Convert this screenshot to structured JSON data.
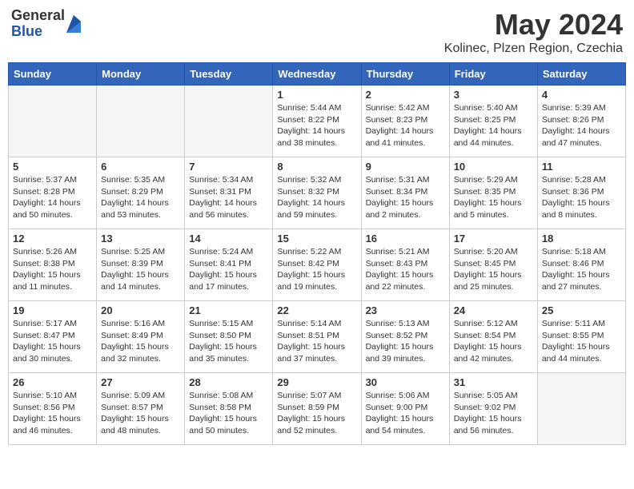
{
  "logo": {
    "general": "General",
    "blue": "Blue"
  },
  "title": "May 2024",
  "location": "Kolinec, Plzen Region, Czechia",
  "headers": [
    "Sunday",
    "Monday",
    "Tuesday",
    "Wednesday",
    "Thursday",
    "Friday",
    "Saturday"
  ],
  "weeks": [
    [
      {
        "day": "",
        "sunrise": "",
        "sunset": "",
        "daylight": ""
      },
      {
        "day": "",
        "sunrise": "",
        "sunset": "",
        "daylight": ""
      },
      {
        "day": "",
        "sunrise": "",
        "sunset": "",
        "daylight": ""
      },
      {
        "day": "1",
        "sunrise": "Sunrise: 5:44 AM",
        "sunset": "Sunset: 8:22 PM",
        "daylight": "Daylight: 14 hours and 38 minutes."
      },
      {
        "day": "2",
        "sunrise": "Sunrise: 5:42 AM",
        "sunset": "Sunset: 8:23 PM",
        "daylight": "Daylight: 14 hours and 41 minutes."
      },
      {
        "day": "3",
        "sunrise": "Sunrise: 5:40 AM",
        "sunset": "Sunset: 8:25 PM",
        "daylight": "Daylight: 14 hours and 44 minutes."
      },
      {
        "day": "4",
        "sunrise": "Sunrise: 5:39 AM",
        "sunset": "Sunset: 8:26 PM",
        "daylight": "Daylight: 14 hours and 47 minutes."
      }
    ],
    [
      {
        "day": "5",
        "sunrise": "Sunrise: 5:37 AM",
        "sunset": "Sunset: 8:28 PM",
        "daylight": "Daylight: 14 hours and 50 minutes."
      },
      {
        "day": "6",
        "sunrise": "Sunrise: 5:35 AM",
        "sunset": "Sunset: 8:29 PM",
        "daylight": "Daylight: 14 hours and 53 minutes."
      },
      {
        "day": "7",
        "sunrise": "Sunrise: 5:34 AM",
        "sunset": "Sunset: 8:31 PM",
        "daylight": "Daylight: 14 hours and 56 minutes."
      },
      {
        "day": "8",
        "sunrise": "Sunrise: 5:32 AM",
        "sunset": "Sunset: 8:32 PM",
        "daylight": "Daylight: 14 hours and 59 minutes."
      },
      {
        "day": "9",
        "sunrise": "Sunrise: 5:31 AM",
        "sunset": "Sunset: 8:34 PM",
        "daylight": "Daylight: 15 hours and 2 minutes."
      },
      {
        "day": "10",
        "sunrise": "Sunrise: 5:29 AM",
        "sunset": "Sunset: 8:35 PM",
        "daylight": "Daylight: 15 hours and 5 minutes."
      },
      {
        "day": "11",
        "sunrise": "Sunrise: 5:28 AM",
        "sunset": "Sunset: 8:36 PM",
        "daylight": "Daylight: 15 hours and 8 minutes."
      }
    ],
    [
      {
        "day": "12",
        "sunrise": "Sunrise: 5:26 AM",
        "sunset": "Sunset: 8:38 PM",
        "daylight": "Daylight: 15 hours and 11 minutes."
      },
      {
        "day": "13",
        "sunrise": "Sunrise: 5:25 AM",
        "sunset": "Sunset: 8:39 PM",
        "daylight": "Daylight: 15 hours and 14 minutes."
      },
      {
        "day": "14",
        "sunrise": "Sunrise: 5:24 AM",
        "sunset": "Sunset: 8:41 PM",
        "daylight": "Daylight: 15 hours and 17 minutes."
      },
      {
        "day": "15",
        "sunrise": "Sunrise: 5:22 AM",
        "sunset": "Sunset: 8:42 PM",
        "daylight": "Daylight: 15 hours and 19 minutes."
      },
      {
        "day": "16",
        "sunrise": "Sunrise: 5:21 AM",
        "sunset": "Sunset: 8:43 PM",
        "daylight": "Daylight: 15 hours and 22 minutes."
      },
      {
        "day": "17",
        "sunrise": "Sunrise: 5:20 AM",
        "sunset": "Sunset: 8:45 PM",
        "daylight": "Daylight: 15 hours and 25 minutes."
      },
      {
        "day": "18",
        "sunrise": "Sunrise: 5:18 AM",
        "sunset": "Sunset: 8:46 PM",
        "daylight": "Daylight: 15 hours and 27 minutes."
      }
    ],
    [
      {
        "day": "19",
        "sunrise": "Sunrise: 5:17 AM",
        "sunset": "Sunset: 8:47 PM",
        "daylight": "Daylight: 15 hours and 30 minutes."
      },
      {
        "day": "20",
        "sunrise": "Sunrise: 5:16 AM",
        "sunset": "Sunset: 8:49 PM",
        "daylight": "Daylight: 15 hours and 32 minutes."
      },
      {
        "day": "21",
        "sunrise": "Sunrise: 5:15 AM",
        "sunset": "Sunset: 8:50 PM",
        "daylight": "Daylight: 15 hours and 35 minutes."
      },
      {
        "day": "22",
        "sunrise": "Sunrise: 5:14 AM",
        "sunset": "Sunset: 8:51 PM",
        "daylight": "Daylight: 15 hours and 37 minutes."
      },
      {
        "day": "23",
        "sunrise": "Sunrise: 5:13 AM",
        "sunset": "Sunset: 8:52 PM",
        "daylight": "Daylight: 15 hours and 39 minutes."
      },
      {
        "day": "24",
        "sunrise": "Sunrise: 5:12 AM",
        "sunset": "Sunset: 8:54 PM",
        "daylight": "Daylight: 15 hours and 42 minutes."
      },
      {
        "day": "25",
        "sunrise": "Sunrise: 5:11 AM",
        "sunset": "Sunset: 8:55 PM",
        "daylight": "Daylight: 15 hours and 44 minutes."
      }
    ],
    [
      {
        "day": "26",
        "sunrise": "Sunrise: 5:10 AM",
        "sunset": "Sunset: 8:56 PM",
        "daylight": "Daylight: 15 hours and 46 minutes."
      },
      {
        "day": "27",
        "sunrise": "Sunrise: 5:09 AM",
        "sunset": "Sunset: 8:57 PM",
        "daylight": "Daylight: 15 hours and 48 minutes."
      },
      {
        "day": "28",
        "sunrise": "Sunrise: 5:08 AM",
        "sunset": "Sunset: 8:58 PM",
        "daylight": "Daylight: 15 hours and 50 minutes."
      },
      {
        "day": "29",
        "sunrise": "Sunrise: 5:07 AM",
        "sunset": "Sunset: 8:59 PM",
        "daylight": "Daylight: 15 hours and 52 minutes."
      },
      {
        "day": "30",
        "sunrise": "Sunrise: 5:06 AM",
        "sunset": "Sunset: 9:00 PM",
        "daylight": "Daylight: 15 hours and 54 minutes."
      },
      {
        "day": "31",
        "sunrise": "Sunrise: 5:05 AM",
        "sunset": "Sunset: 9:02 PM",
        "daylight": "Daylight: 15 hours and 56 minutes."
      },
      {
        "day": "",
        "sunrise": "",
        "sunset": "",
        "daylight": ""
      }
    ]
  ]
}
